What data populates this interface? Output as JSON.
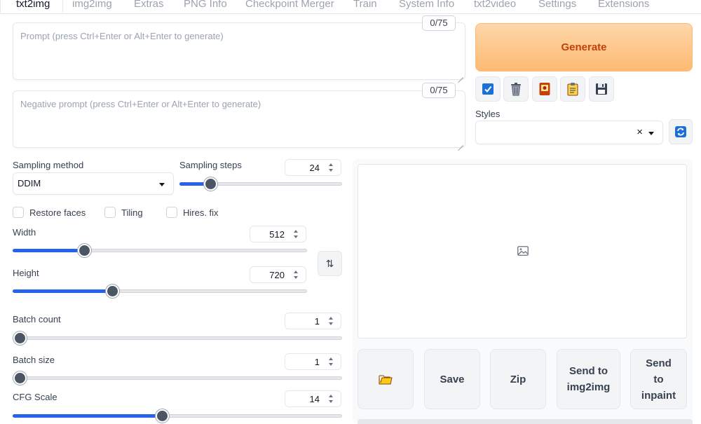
{
  "tabs": [
    {
      "label": "txt2img",
      "active": true
    },
    {
      "label": "img2img"
    },
    {
      "label": "Extras"
    },
    {
      "label": "PNG Info"
    },
    {
      "label": "Checkpoint Merger"
    },
    {
      "label": "Train"
    },
    {
      "label": "System Info"
    },
    {
      "label": "txt2video"
    },
    {
      "label": "Settings"
    },
    {
      "label": "Extensions"
    }
  ],
  "prompt": {
    "placeholder": "Prompt (press Ctrl+Enter or Alt+Enter to generate)",
    "value": "",
    "counter": "0/75"
  },
  "negative_prompt": {
    "placeholder": "Negative prompt (press Ctrl+Enter or Alt+Enter to generate)",
    "value": "",
    "counter": "0/75"
  },
  "generate_label": "Generate",
  "tool_buttons": [
    {
      "icon": "checkbox-icon"
    },
    {
      "icon": "trash-icon"
    },
    {
      "icon": "red-card-icon"
    },
    {
      "icon": "clipboard-icon"
    },
    {
      "icon": "floppy-disk-icon"
    }
  ],
  "styles": {
    "label": "Styles",
    "value": ""
  },
  "sampling_method": {
    "label": "Sampling method",
    "value": "DDIM"
  },
  "sampling_steps": {
    "label": "Sampling steps",
    "value": "24",
    "fraction": 0.16
  },
  "checkboxes": {
    "restore_faces": {
      "label": "Restore faces",
      "checked": false
    },
    "tiling": {
      "label": "Tiling",
      "checked": false
    },
    "hires_fix": {
      "label": "Hires. fix",
      "checked": false
    }
  },
  "width": {
    "label": "Width",
    "value": "512",
    "fraction": 0.23
  },
  "height": {
    "label": "Height",
    "value": "720",
    "fraction": 0.33
  },
  "swap_icon": "⇅",
  "batch_count": {
    "label": "Batch count",
    "value": "1",
    "fraction": 0.0
  },
  "batch_size": {
    "label": "Batch size",
    "value": "1",
    "fraction": 0.0
  },
  "cfg_scale": {
    "label": "CFG Scale",
    "value": "14",
    "fraction": 0.45
  },
  "actions": {
    "folder_icon": "folder-icon",
    "save": "Save",
    "zip": "Zip",
    "send_img2img": "Send to img2img",
    "send_inpaint": "Send to inpaint"
  },
  "colors": {
    "accent": "#2563eb",
    "generate_bg": "#fdba74",
    "generate_text": "#c2410c"
  }
}
